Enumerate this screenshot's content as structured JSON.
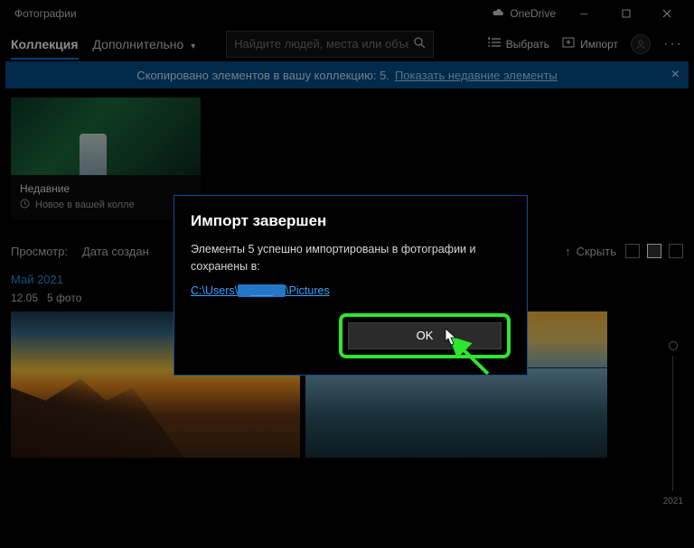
{
  "titlebar": {
    "app_name": "Фотографии",
    "onedrive": "OneDrive"
  },
  "topnav": {
    "tab_collection": "Коллекция",
    "tab_more": "Дополнительно",
    "search_placeholder": "Найдите людей, места или объекты.",
    "select_label": "Выбрать",
    "import_label": "Импорт"
  },
  "notification": {
    "text": "Скопировано элементов в вашу коллекцию: 5.",
    "link": "Показать недавние элементы"
  },
  "recent_card": {
    "title": "Недавние",
    "sub": "Новое в вашей колле"
  },
  "row_meta": {
    "view_label": "Просмотр:",
    "sort_label": "Дата создан",
    "hide_label": "Скрыть"
  },
  "month": {
    "label": "Май 2021",
    "date": "12.05",
    "count": "5 фото"
  },
  "timeline": {
    "year": "2021"
  },
  "dialog": {
    "title": "Импорт завершен",
    "body": "Элементы 5 успешно импортированы в фотографии и сохранены в:",
    "path_pre": "C:\\Users\\",
    "path_post": "\\Pictures",
    "ok": "OK"
  }
}
